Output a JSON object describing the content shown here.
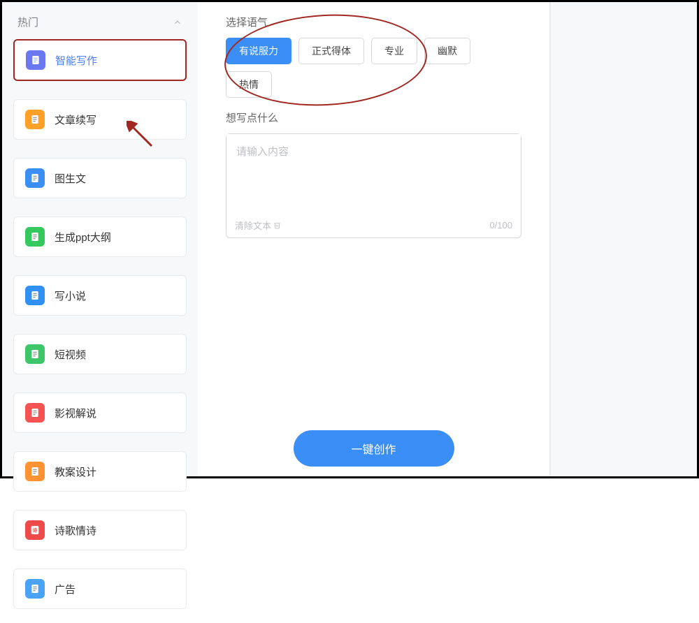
{
  "sidebar": {
    "header_label": "热门",
    "items": [
      {
        "label": "智能写作",
        "icon_name": "doc-pencil-icon",
        "color": "icon-blue-purple",
        "highlighted": true
      },
      {
        "label": "文章续写",
        "icon_name": "doc-lines-icon",
        "color": "icon-orange",
        "highlighted": false
      },
      {
        "label": "图生文",
        "icon_name": "image-text-icon",
        "color": "icon-blue",
        "highlighted": false
      },
      {
        "label": "生成ppt大纲",
        "icon_name": "slides-icon",
        "color": "icon-green",
        "highlighted": false
      },
      {
        "label": "写小说",
        "icon_name": "doc-icon",
        "color": "icon-blue2",
        "highlighted": false
      },
      {
        "label": "短视频",
        "icon_name": "doc-lines-icon",
        "color": "icon-green2",
        "highlighted": false
      },
      {
        "label": "影视解说",
        "icon_name": "doc-lines-icon",
        "color": "icon-red",
        "highlighted": false
      },
      {
        "label": "教案设计",
        "icon_name": "doc-lines-icon",
        "color": "icon-orange2",
        "highlighted": false
      },
      {
        "label": "诗歌情诗",
        "icon_name": "poem-icon",
        "color": "icon-red2",
        "highlighted": false
      },
      {
        "label": "广告",
        "icon_name": "doc-icon",
        "color": "icon-blue3",
        "highlighted": false
      }
    ]
  },
  "main": {
    "tone_label": "选择语气",
    "tones": [
      {
        "label": "有说服力",
        "active": true
      },
      {
        "label": "正式得体",
        "active": false
      },
      {
        "label": "专业",
        "active": false
      },
      {
        "label": "幽默",
        "active": false
      },
      {
        "label": "热情",
        "active": false
      }
    ],
    "prompt_label": "想写点什么",
    "textarea_placeholder": "请输入内容",
    "clear_label": "清除文本",
    "char_count": "0/100",
    "create_label": "一键创作"
  }
}
